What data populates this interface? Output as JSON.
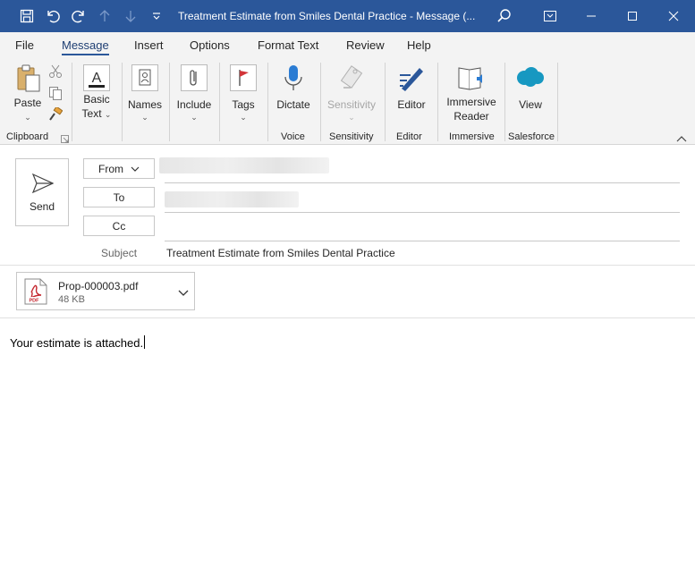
{
  "window": {
    "title": "Treatment Estimate from Smiles Dental Practice  -  Message (..."
  },
  "tabs": [
    "File",
    "Message",
    "Insert",
    "Options",
    "Format Text",
    "Review",
    "Help"
  ],
  "ribbon": {
    "paste": "Paste",
    "basic_text_1": "Basic",
    "basic_text_2": "Text",
    "names": "Names",
    "include": "Include",
    "tags": "Tags",
    "dictate": "Dictate",
    "sensitivity": "Sensitivity",
    "editor": "Editor",
    "immersive_1": "Immersive",
    "immersive_2": "Reader",
    "view": "View",
    "groups": {
      "clipboard": "Clipboard",
      "voice": "Voice",
      "sensitivity": "Sensitivity",
      "editor": "Editor",
      "immersive": "Immersive",
      "salesforce": "Salesforce"
    }
  },
  "compose": {
    "send": "Send",
    "from": "From",
    "to": "To",
    "cc": "Cc",
    "subject_label": "Subject",
    "subject_value": "Treatment Estimate from Smiles Dental Practice",
    "attachment_name": "Prop-000003.pdf",
    "attachment_size": "48 KB",
    "attachment_type": "PDF",
    "body": "Your estimate is attached."
  },
  "colors": {
    "title_bar": "#2b579a",
    "ribbon_bg": "#f3f3f3",
    "pdf_red": "#c4262e",
    "salesforce_blue": "#1798c1",
    "dictate_blue": "#2b7cd3"
  }
}
